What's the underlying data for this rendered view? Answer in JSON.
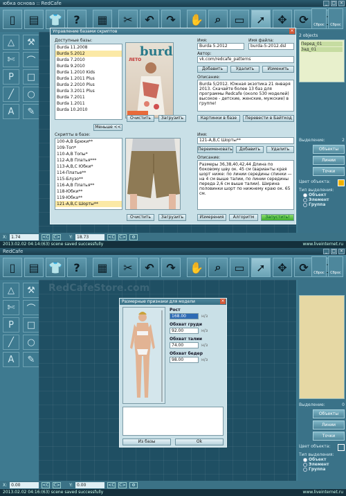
{
  "top": {
    "title": "юбка основа :: RedCafe",
    "reset_labels": [
      "Сброс",
      "Сброс"
    ],
    "right": {
      "count": "2 objects",
      "items": [
        "Перед_01",
        "Зад_01"
      ],
      "sel_label": "Выделение:",
      "sel_count": "2",
      "buttons": [
        "Объекты",
        "Линии",
        "Точки"
      ],
      "color_label": "Цвет объекта:",
      "type_label": "Тип выделения:",
      "radios": [
        "Объект",
        "Элемент",
        "Группа"
      ]
    },
    "coord": {
      "x_label": "X:",
      "x_val": "1.74",
      "y_label": "Y:",
      "y_val": "18.73",
      "btn_prev": "<C",
      "btn_next": "C>"
    },
    "status": "2013.02.02 04:14:(63) scene saved successfully",
    "watermark": "www.liveinternet.ru",
    "dialog": {
      "title": "Управление базами скриптов",
      "avail_label": "Доступные базы:",
      "bases": [
        "Burda 11.2008",
        "Burda 5.2012",
        "Burda 7.2010",
        "Burda 9.2010",
        "Burda 1.2010 Kids",
        "Burda 1.2011 Plus",
        "Burda 2.2010 Plus",
        "Burda 3.2011 Plus",
        "Burda 7.2011",
        "Burda 1.2011",
        "Burda 10.2010"
      ],
      "less_btn": "Меньше <<",
      "scripts_label": "Скрипты в базе:",
      "scripts": [
        "100-А,В Брюки**",
        "109-Топ*",
        "110-А,В Топы*",
        "112-А,В Платья***",
        "113-А,В,С Юбки*",
        "114-Платье**",
        "115-Блузо**",
        "116-А,В Платья**",
        "118-Юбки**",
        "119-Юбка**",
        "121-А,В,С Шорты**"
      ],
      "name_label": "Имя:",
      "name_val": "Burda 5.2012",
      "file_label": "Имя файла:",
      "file_val": "burda-5-2012.dsl",
      "author_label": "Автор:",
      "author_val": "vk.com/redcafe_patterns",
      "btn_add": "Добавить",
      "btn_del": "Удалить",
      "btn_edit": "Изменить",
      "desc_label": "Описание:",
      "desc_val": "Burda 5/2012. Южная экзотика 21 января 2013. Скачайте более 13 баз для программы Redcafe (около 530 моделей) высокое - детские, женские, мужские) в группе!",
      "btn_clear": "Очистить",
      "btn_load": "Загрузить",
      "btn_picbase": "Картинки в базе",
      "btn_bytecode": "Перевести в Байткод",
      "script_name_label": "Имя:",
      "script_name_val": "121-А,В,С Шорты**",
      "btn_rename": "Переименовать",
      "btn_add2": "Добавить",
      "btn_del2": "Удалить",
      "script_desc_label": "Описание:",
      "script_desc_val": "Размеры 36,38,40,42,44 Длина по боковому шву ок. 45 см (варианты края шорт ниже: по линии середины спинки — на 4 см выше талии, по линии середины переда 2,6 см выше талии). Ширина половинки шорт по нижнему краю ок. 65 см.",
      "btn_clear2": "Очистить",
      "btn_load2": "Загрузить",
      "btn_measure": "Измерения",
      "btn_algo": "Алгоритм",
      "btn_run": "Запустить!"
    }
  },
  "bottom": {
    "title": "RedCafe",
    "watermark_site": "RedCafeStore.com",
    "reset_labels": [
      "Сброс",
      "Сброс"
    ],
    "right": {
      "sel_label": "Выделение:",
      "sel_count": "0",
      "buttons": [
        "Объекты",
        "Линии",
        "Точки"
      ],
      "color_label": "Цвет объекта:",
      "type_label": "Тип выделения:",
      "radios": [
        "Объект",
        "Элемент",
        "Группа"
      ]
    },
    "coord": {
      "x_label": "X:",
      "x_val": "0.00",
      "y_label": "Y:",
      "y_val": "0.00",
      "btn_prev": "<C",
      "btn_next": "C>"
    },
    "status": "2013.02.02 04:16:(63) scene saved successfully",
    "watermark": "www.liveinternet.ru",
    "dialog": {
      "title": "Размерные признаки для модели",
      "rost_label": "Рост",
      "rost_val": "168.00",
      "og_label": "Обхват груди",
      "og_val": "92.00",
      "ot_label": "Обхват талии",
      "ot_val": "74.00",
      "ob_label": "Обхват бедер",
      "ob_val": "98.00",
      "unit": "н/з",
      "btn_frombase": "Из базы",
      "btn_ok": "Ok"
    }
  }
}
